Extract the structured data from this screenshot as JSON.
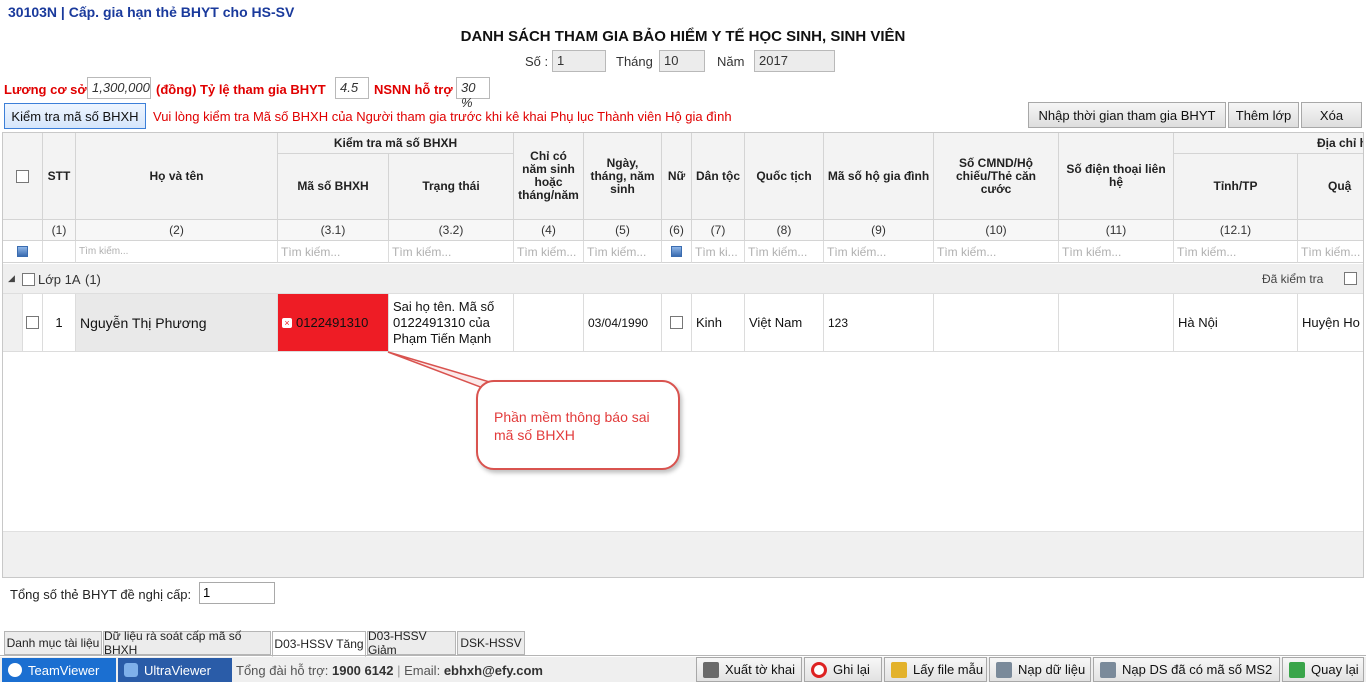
{
  "window_title": "30103N | Cấp. gia hạn thẻ BHYT cho HS-SV",
  "doc_title": "DANH SÁCH THAM GIA BẢO HIỂM Y TẾ HỌC SINH, SINH VIÊN",
  "form": {
    "so_label": "Số :",
    "so_value": "1",
    "thang_label": "Tháng",
    "thang_value": "10",
    "nam_label": "Năm",
    "nam_value": "2017",
    "luong_label": "Lương cơ sở",
    "luong_value": "1,300,000",
    "dong_label": "(đồng) Tỷ lệ tham gia BHYT",
    "tyle_value": "4.5",
    "nsnn_label": "NSNN hỗ trợ",
    "nsnn_value": "30 %"
  },
  "toolbar": {
    "check_btn": "Kiểm tra mã số BHXH",
    "warning": "Vui lòng kiểm tra Mã số BHXH của Người tham gia trước khi kê khai Phụ lục Thành viên Hộ gia đình",
    "import_time_btn": "Nhập thời gian tham gia BHYT",
    "add_class_btn": "Thêm lớp",
    "delete_btn": "Xóa"
  },
  "grid": {
    "group_header": "Kiểm tra mã số BHXH",
    "address_header": "Địa chỉ h",
    "headers": {
      "stt": "STT",
      "name": "Họ và tên",
      "code": "Mã số BHXH",
      "status": "Trạng thái",
      "year_only": "Chỉ có năm sinh hoặc tháng/năm",
      "dob": "Ngày, tháng, năm sinh",
      "female": "Nữ",
      "ethnic": "Dân tộc",
      "nation": "Quốc tịch",
      "household": "Mã số hộ gia đình",
      "idcard": "Số CMND/Hộ chiếu/Thẻ căn cước",
      "phone": "Số điện thoại liên hệ",
      "province": "Tỉnh/TP",
      "district": "Quậ"
    },
    "numbers": {
      "stt": "(1)",
      "name": "(2)",
      "code": "(3.1)",
      "status": "(3.2)",
      "year_only": "(4)",
      "dob": "(5)",
      "female": "(6)",
      "ethnic": "(7)",
      "nation": "(8)",
      "household": "(9)",
      "idcard": "(10)",
      "phone": "(11)",
      "province": "(12.1)"
    },
    "search_placeholder": "Tìm kiếm...",
    "search_short": "Tìm ki...",
    "search_name": "Tìm kiếm...",
    "group_row": {
      "label": "Lớp 1A",
      "count": "(1)",
      "checked_label": "Đã kiểm tra"
    },
    "rows": [
      {
        "stt": "1",
        "name": "Nguyễn Thị Phương",
        "code": "0122491310",
        "status": "Sai họ tên. Mã số 0122491310 của Phạm Tiến Mạnh",
        "year_only": "",
        "dob": "03/04/1990",
        "ethnic": "Kinh",
        "nation": "Việt Nam",
        "household": "123",
        "idcard": "",
        "phone": "",
        "province": "Hà Nội",
        "district": "Huyện Ho"
      }
    ]
  },
  "callout": "Phần mềm thông báo sai mã số BHXH",
  "total_label": "Tổng số thẻ BHYT đề nghị cấp:",
  "total_value": "1",
  "tabs": [
    "Danh mục tài liệu",
    "Dữ liệu rà soát cấp mã số BHXH",
    "D03-HSSV Tăng",
    "D03-HSSV Giảm",
    "DSK-HSSV"
  ],
  "active_tab": "D03-HSSV Tăng",
  "footer": {
    "teamviewer": "TeamViewer",
    "ultraviewer": "UltraViewer",
    "hotline_label": "Tổng đài hỗ trợ:",
    "hotline": "1900 6142",
    "email_label": "Email:",
    "email": "ebhxh@efy.com"
  },
  "bottom_buttons": [
    "Xuất tờ khai",
    "Ghi lại",
    "Lấy file mẫu",
    "Nạp dữ liệu",
    "Nạp DS đã có mã số MS2",
    "Quay lại"
  ],
  "colors": {
    "error_cell": "#ee1c25",
    "callout_border": "#d9534f",
    "callout_text": "#e23b3b",
    "title_blue": "#1a3a9c"
  }
}
